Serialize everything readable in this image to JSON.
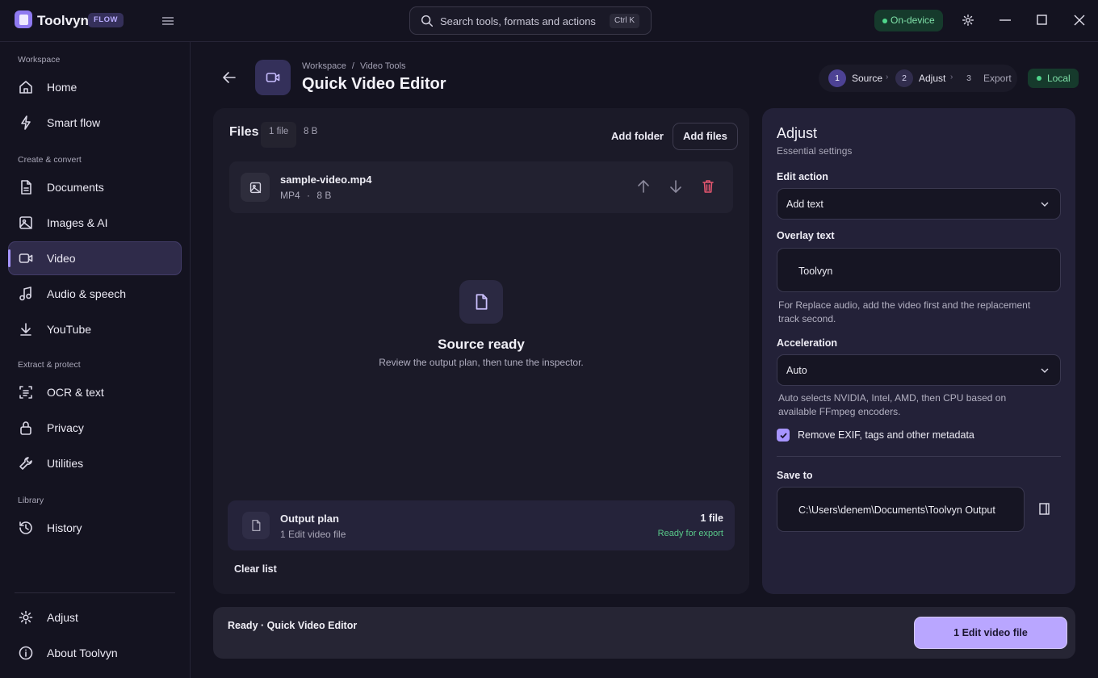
{
  "app": {
    "name": "Toolvyn",
    "badge": "FLOW"
  },
  "search": {
    "placeholder": "Search tools, formats and actions",
    "shortcut": "Ctrl K"
  },
  "status_pill": "On-device",
  "sidebar": {
    "sections": [
      {
        "title": "Workspace",
        "items": [
          {
            "label": "Home",
            "icon": "home-icon"
          },
          {
            "label": "Smart flow",
            "icon": "lightning-icon"
          }
        ]
      },
      {
        "title": "Create & convert",
        "items": [
          {
            "label": "Documents",
            "icon": "document-icon"
          },
          {
            "label": "Images & AI",
            "icon": "image-icon"
          },
          {
            "label": "Video",
            "icon": "video-icon",
            "active": true
          },
          {
            "label": "Audio & speech",
            "icon": "music-icon"
          },
          {
            "label": "YouTube",
            "icon": "download-icon"
          }
        ]
      },
      {
        "title": "Extract & protect",
        "items": [
          {
            "label": "OCR & text",
            "icon": "ocr-icon"
          },
          {
            "label": "Privacy",
            "icon": "lock-icon"
          },
          {
            "label": "Utilities",
            "icon": "wrench-icon"
          }
        ]
      },
      {
        "title": "Library",
        "items": [
          {
            "label": "History",
            "icon": "history-icon"
          }
        ]
      }
    ],
    "bottom": [
      {
        "label": "Adjust",
        "icon": "gear-icon"
      },
      {
        "label": "About Toolvyn",
        "icon": "info-icon"
      }
    ]
  },
  "header": {
    "breadcrumb": [
      "Workspace",
      "Video Tools"
    ],
    "breadcrumb_sep": "/",
    "title": "Quick Video Editor",
    "steps": [
      {
        "num": "1",
        "label": "Source"
      },
      {
        "num": "2",
        "label": "Adjust"
      },
      {
        "num": "3",
        "label": "Export"
      }
    ],
    "mode_pill": "Local"
  },
  "files": {
    "title": "Files",
    "count": "1 file",
    "size": "8 B",
    "add_folder": "Add folder",
    "add_files": "Add files",
    "items": [
      {
        "name": "sample-video.mp4",
        "format": "MP4",
        "size": "8 B",
        "meta_sep": "·"
      }
    ],
    "empty_title": "Source ready",
    "empty_sub": "Review the output plan, then tune the inspector.",
    "output_plan": {
      "title": "Output plan",
      "sub": "1 Edit video file",
      "count": "1 file",
      "status": "Ready for export"
    },
    "clear": "Clear list"
  },
  "adjust": {
    "title": "Adjust",
    "subtitle": "Essential settings",
    "edit_action_label": "Edit action",
    "edit_action_value": "Add text",
    "overlay_label": "Overlay text",
    "overlay_value": "Toolvyn",
    "overlay_hint": "For Replace audio, add the video first and the replacement track second.",
    "accel_label": "Acceleration",
    "accel_value": "Auto",
    "accel_hint": "Auto selects NVIDIA, Intel, AMD, then CPU based on available FFmpeg encoders.",
    "metadata_label": "Remove EXIF, tags and other metadata",
    "metadata_checked": true,
    "save_label": "Save to",
    "save_path": "C:\\Users\\denem\\Documents\\Toolvyn Output"
  },
  "statusbar": {
    "text": "Ready · Quick Video Editor",
    "button": "1 Edit video file"
  },
  "colors": {
    "accent": "#a795ff",
    "success": "#4fd68b",
    "background": "#141320",
    "danger": "#e5566f"
  }
}
